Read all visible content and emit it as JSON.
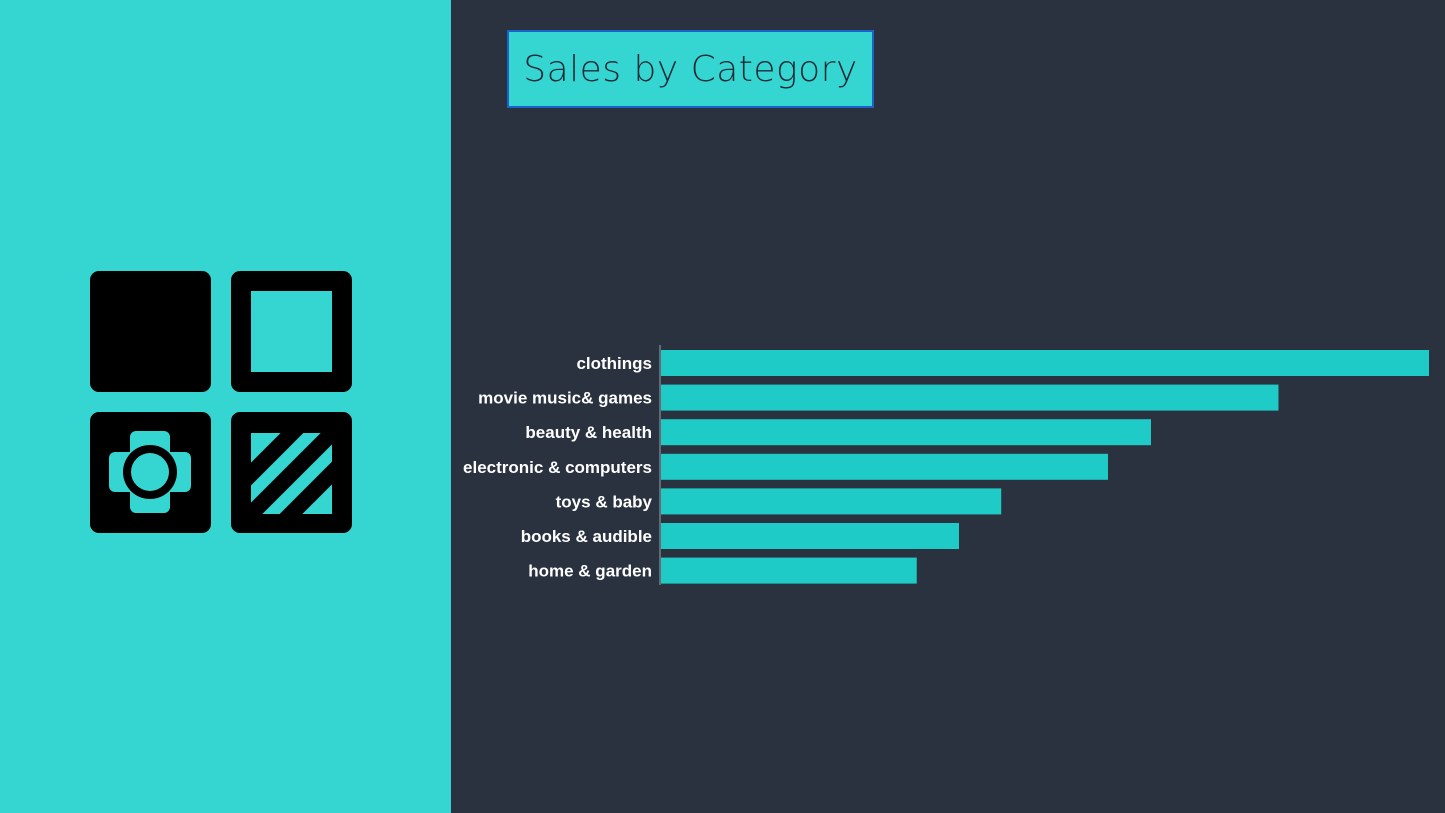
{
  "colors": {
    "left_panel": "#35d6d1",
    "background": "#2a3240",
    "bar": "#1fcbc6",
    "title_border": "#1b63c9",
    "logo": "#000000"
  },
  "logo": {
    "icons": [
      "solid-square-icon",
      "hollow-square-icon",
      "cross-circle-icon",
      "diagonal-stripes-icon"
    ]
  },
  "chart_data": {
    "type": "bar",
    "orientation": "horizontal",
    "title": "Sales by Category",
    "categories": [
      "clothings",
      "movie music& games",
      "beauty & health",
      "electronic & computers",
      "toys & baby",
      "books & audible",
      "home & garden"
    ],
    "values": [
      100,
      80.4,
      63.8,
      58.2,
      44.3,
      38.8,
      33.3
    ],
    "xlim": [
      0,
      100
    ],
    "grid": false,
    "legend": "none",
    "axis_ticks_shown": false
  }
}
